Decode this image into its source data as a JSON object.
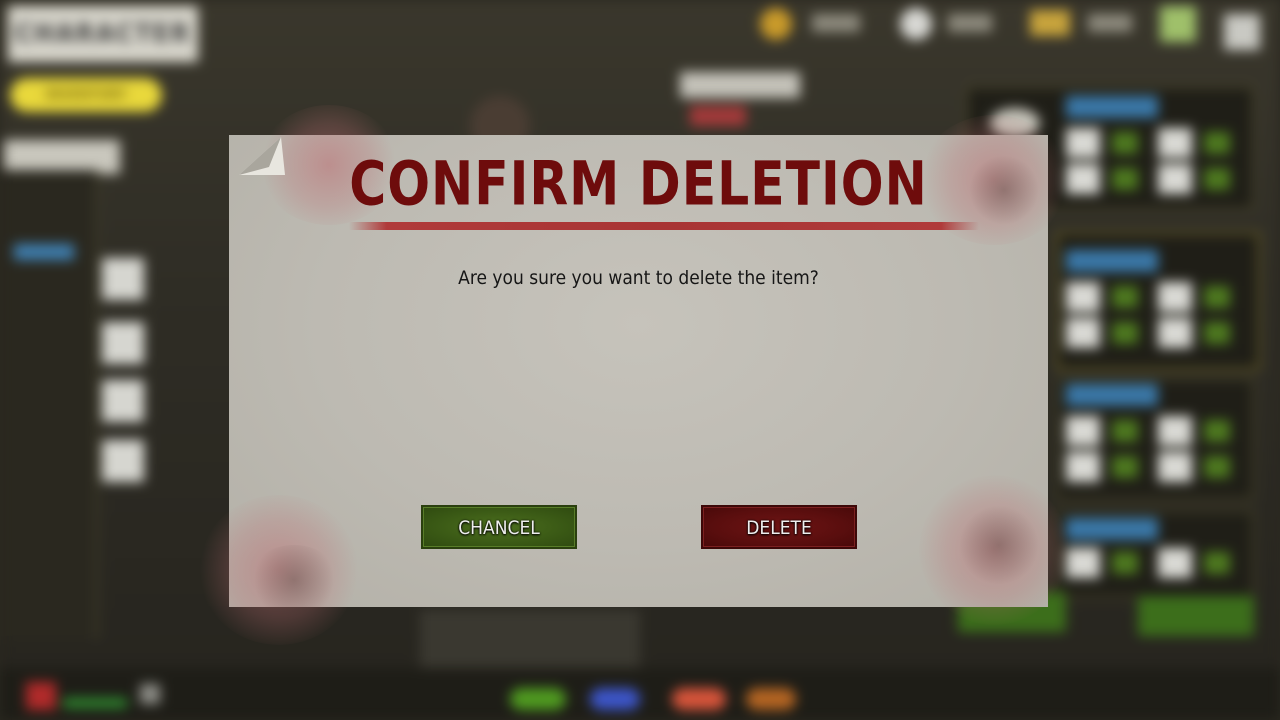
{
  "background": {
    "tab_title": "CHARACTER",
    "yellow_pill": "INVENTORY"
  },
  "dialog": {
    "title": "CONFIRM DELETION",
    "message": "Are you sure you want to delete the item?",
    "cancel_label": "CHANCEL",
    "delete_label": "DELETE"
  },
  "colors": {
    "title": "#6e0c0c",
    "title_rule": "#b03a3a",
    "paper": "#bfbcb4",
    "cancel_button": "#3a5915",
    "delete_button": "#5a0e0e"
  }
}
